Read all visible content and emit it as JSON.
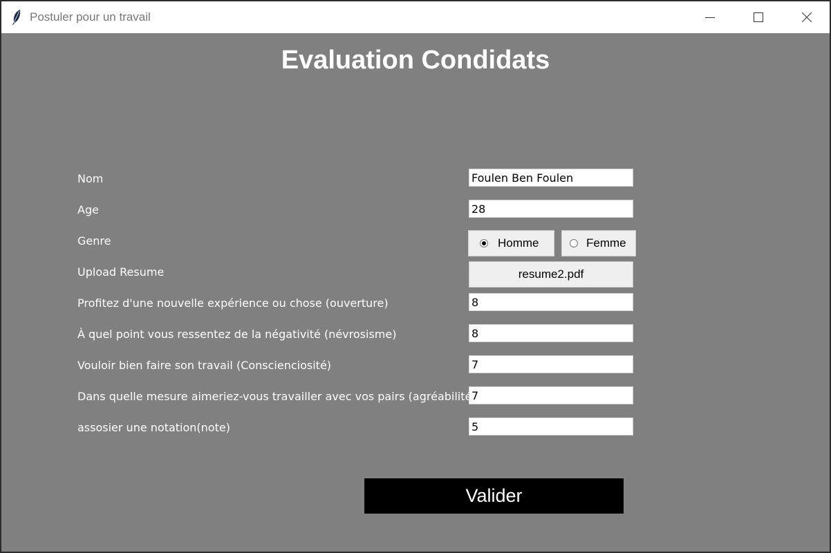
{
  "window": {
    "title": "Postuler pour un travail"
  },
  "heading": "Evaluation Condidats",
  "form": {
    "nom": {
      "label": "Nom",
      "value": "Foulen Ben Foulen"
    },
    "age": {
      "label": "Age",
      "value": "28"
    },
    "genre": {
      "label": "Genre",
      "options": [
        "Homme",
        "Femme"
      ],
      "selected": "Homme"
    },
    "resume": {
      "label": "Upload Resume",
      "file": "resume2.pdf"
    },
    "ouverture": {
      "label": "Profitez d'une nouvelle expérience ou chose (ouverture)",
      "value": "8"
    },
    "nevrosisme": {
      "label": "À quel point vous ressentez de la négativité (névrosisme)",
      "value": "8"
    },
    "conscienciosite": {
      "label": "Vouloir bien faire son travail (Conscienciosité)",
      "value": "7"
    },
    "agreabilite": {
      "label": "Dans quelle mesure aimeriez-vous travailler avec vos pairs (agréabilité)",
      "value": "7"
    },
    "note": {
      "label": "assosier une notation(note)",
      "value": "5"
    }
  },
  "submit_label": "Valider"
}
